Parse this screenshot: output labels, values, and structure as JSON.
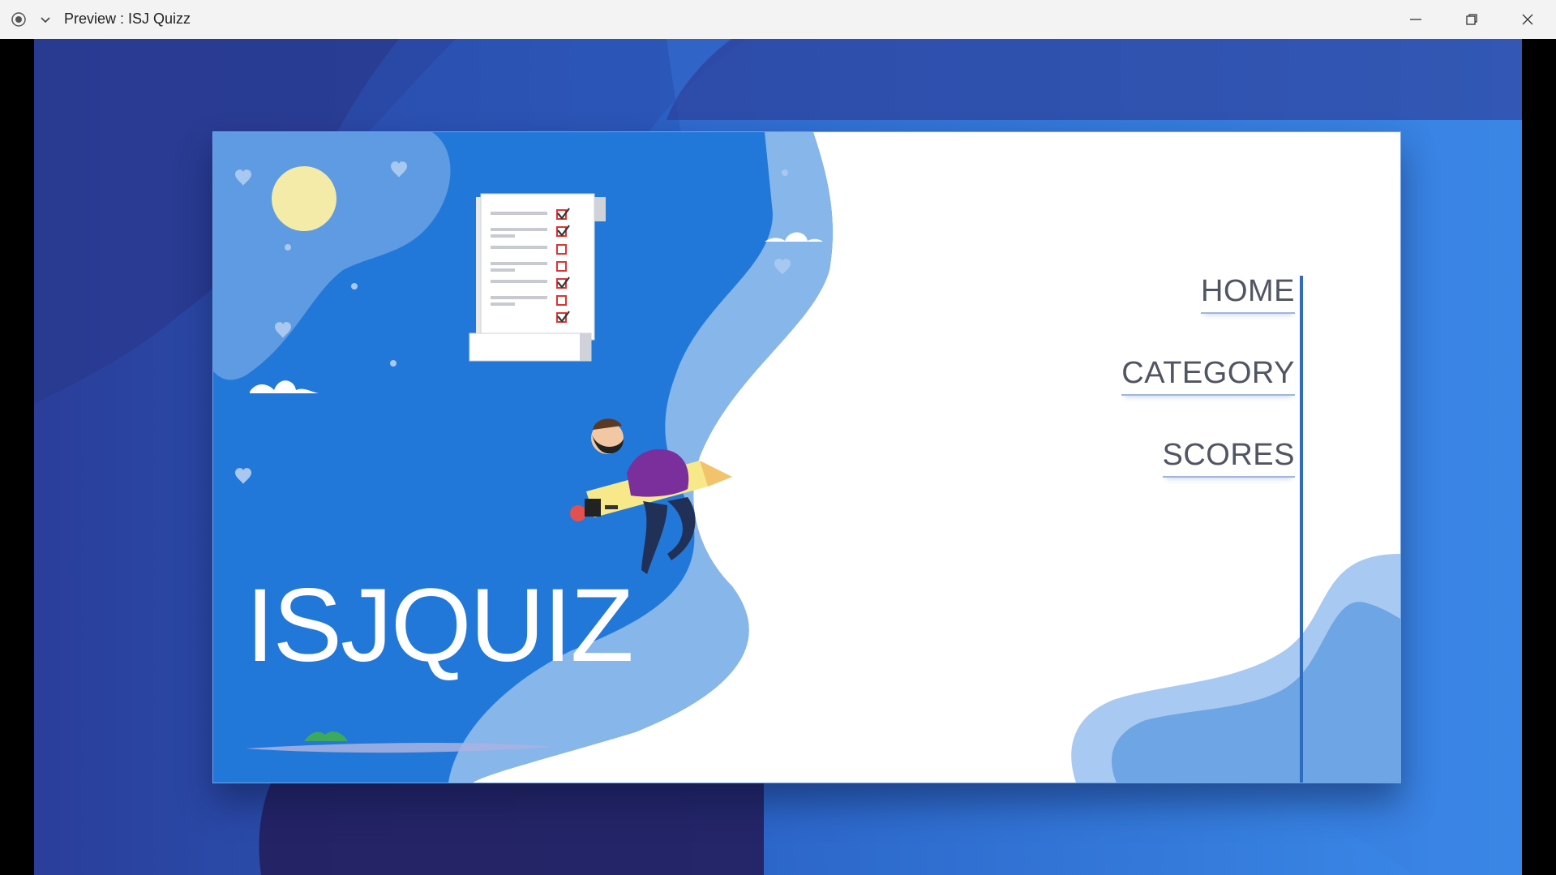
{
  "window": {
    "title": "Preview : ISJ Quizz",
    "record_icon": "record-icon",
    "dropdown_icon": "chevron-down-icon",
    "minimize_icon": "minimize-icon",
    "restore_icon": "restore-icon",
    "close_icon": "close-icon"
  },
  "hero": {
    "brand": "ISJQUIZ"
  },
  "menu": {
    "items": [
      {
        "label": "HOME"
      },
      {
        "label": "CATEGORY"
      },
      {
        "label": "SCORES"
      }
    ]
  },
  "illustration": {
    "checklist": [
      "checked",
      "checked",
      "unchecked",
      "unchecked",
      "checked",
      "unchecked",
      "checked"
    ]
  },
  "colors": {
    "accent": "#2f6cbf",
    "background_dark": "#2a3e9a",
    "background_light": "#3b8bea",
    "card_left": "#2278d8",
    "menu_text": "#505562",
    "sun": "#f3eba7"
  }
}
